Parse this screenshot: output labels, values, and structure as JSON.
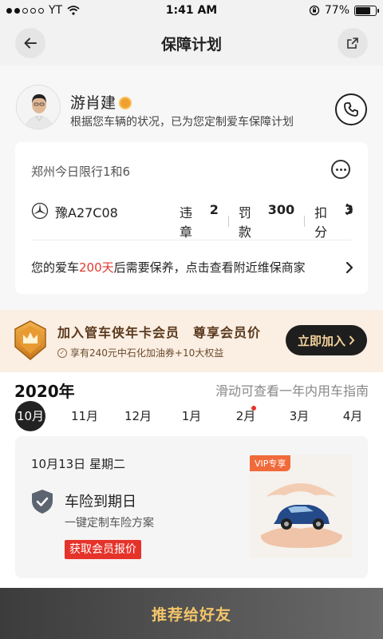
{
  "status_bar": {
    "carrier": "YT",
    "time": "1:41 AM",
    "battery": "77%",
    "battery_level": 0.77
  },
  "header": {
    "title": "保障计划"
  },
  "profile": {
    "name": "游肖建",
    "description": "根据您车辆的状况，已为您定制爱车保障计划"
  },
  "car_card": {
    "restriction": "郑州今日限行1和6",
    "plate": "豫A27C08",
    "violations_label": "违章",
    "violations_value": "2",
    "fine_label": "罚款",
    "fine_value": "300",
    "points_label": "扣分",
    "points_value": "3",
    "maintenance_prefix": "您的爱车",
    "maintenance_days": "200天",
    "maintenance_suffix": "后需要保养，点击查看附近维保商家"
  },
  "banner": {
    "title": "加入管车侠年卡会员　尊享会员价",
    "subtitle": "享有240元中石化加油券+10大权益",
    "button": "立即加入"
  },
  "calendar": {
    "year": "2020年",
    "hint": "滑动可查看一年内用车指南",
    "months": [
      {
        "label": "10月",
        "active": true,
        "dot": false
      },
      {
        "label": "11月",
        "active": false,
        "dot": false
      },
      {
        "label": "12月",
        "active": false,
        "dot": false
      },
      {
        "label": "1月",
        "active": false,
        "dot": false
      },
      {
        "label": "2月",
        "active": false,
        "dot": true
      },
      {
        "label": "3月",
        "active": false,
        "dot": false
      },
      {
        "label": "4月",
        "active": false,
        "dot": false
      }
    ]
  },
  "event": {
    "date": "10月13日 星期二",
    "title": "车险到期日",
    "subtitle": "一键定制车险方案",
    "button": "获取会员报价",
    "vip_tag": "VIP专享"
  },
  "bottom": {
    "button": "推荐给好友"
  },
  "colors": {
    "accent_red": "#e6332a",
    "gold": "#f3c56a",
    "dark": "#1e1e1e"
  }
}
